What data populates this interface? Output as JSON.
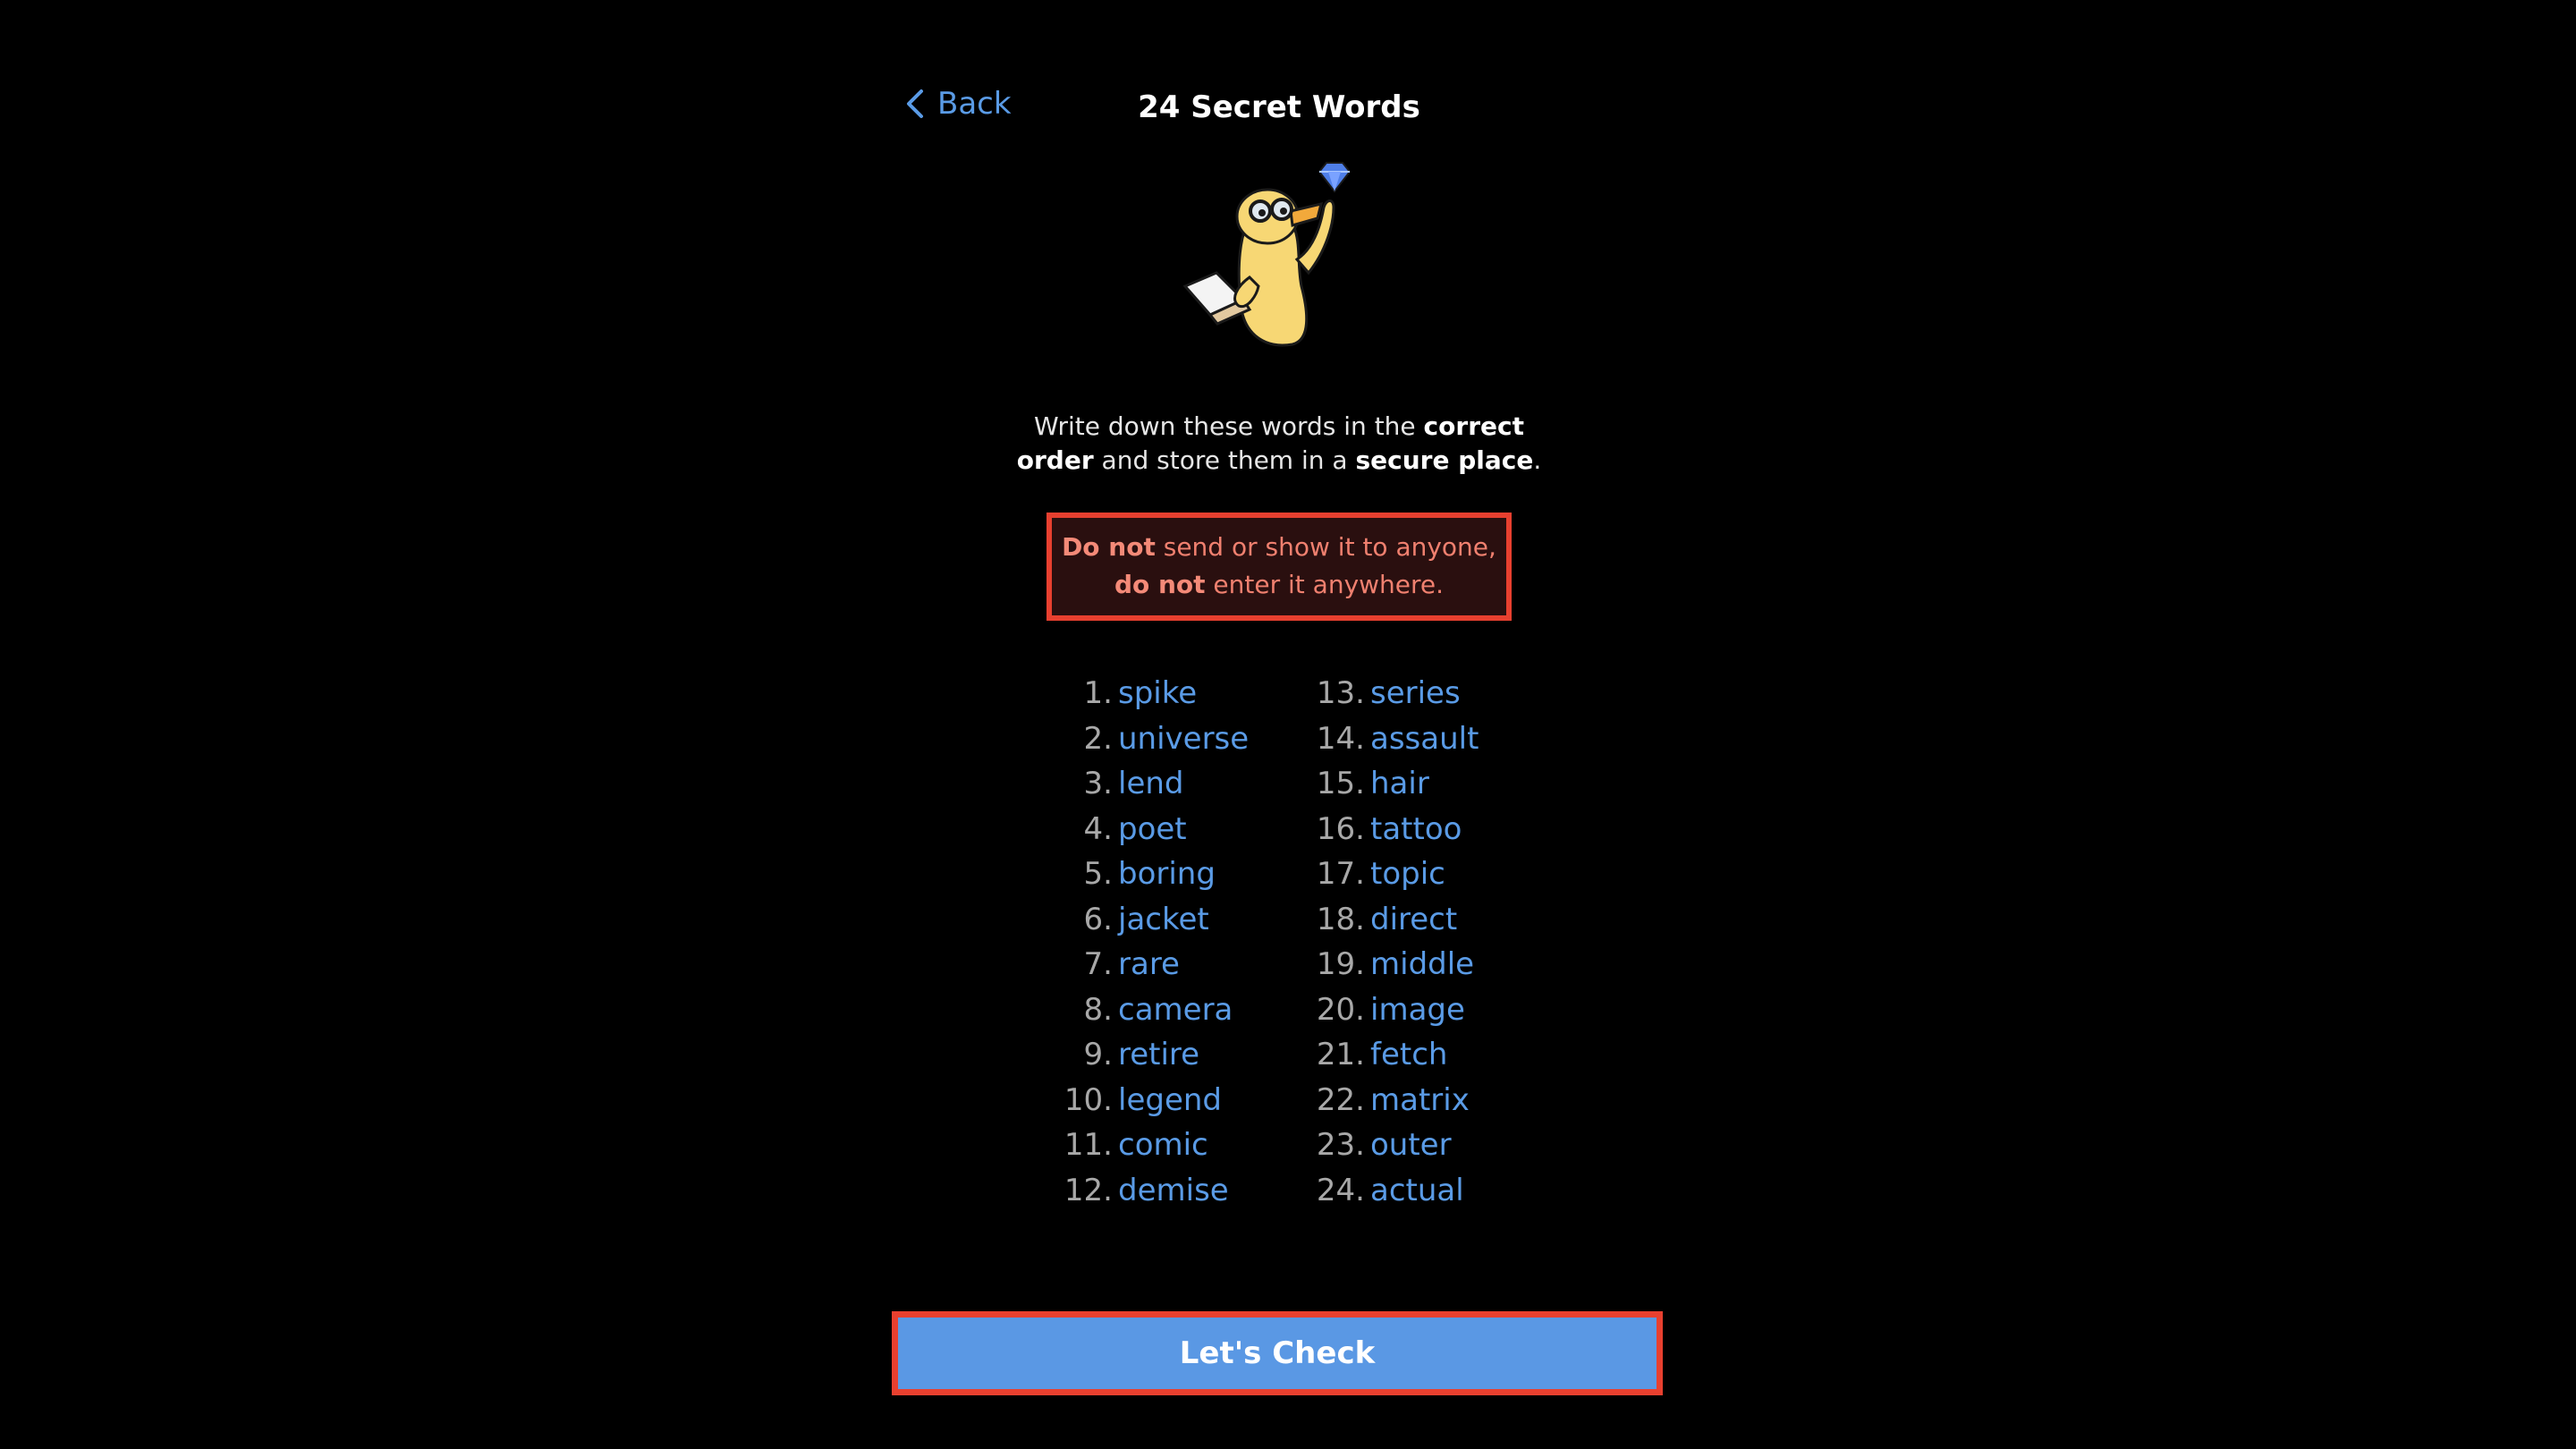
{
  "header": {
    "back_label": "Back",
    "title": "24 Secret Words"
  },
  "intro": {
    "part1": "Write down these words in the ",
    "bold1": "correct order",
    "part2": " and store them in a ",
    "bold2": "secure place",
    "part3": "."
  },
  "warning": {
    "bold1": "Do not",
    "text1": " send or show it to anyone,",
    "bold2": "do not",
    "text2": " enter it anywhere."
  },
  "words": [
    {
      "n": "1.",
      "w": "spike"
    },
    {
      "n": "2.",
      "w": "universe"
    },
    {
      "n": "3.",
      "w": "lend"
    },
    {
      "n": "4.",
      "w": "poet"
    },
    {
      "n": "5.",
      "w": "boring"
    },
    {
      "n": "6.",
      "w": "jacket"
    },
    {
      "n": "7.",
      "w": "rare"
    },
    {
      "n": "8.",
      "w": "camera"
    },
    {
      "n": "9.",
      "w": "retire"
    },
    {
      "n": "10.",
      "w": "legend"
    },
    {
      "n": "11.",
      "w": "comic"
    },
    {
      "n": "12.",
      "w": "demise"
    },
    {
      "n": "13.",
      "w": "series"
    },
    {
      "n": "14.",
      "w": "assault"
    },
    {
      "n": "15.",
      "w": "hair"
    },
    {
      "n": "16.",
      "w": "tattoo"
    },
    {
      "n": "17.",
      "w": "topic"
    },
    {
      "n": "18.",
      "w": "direct"
    },
    {
      "n": "19.",
      "w": "middle"
    },
    {
      "n": "20.",
      "w": "image"
    },
    {
      "n": "21.",
      "w": "fetch"
    },
    {
      "n": "22.",
      "w": "matrix"
    },
    {
      "n": "23.",
      "w": "outer"
    },
    {
      "n": "24.",
      "w": "actual"
    }
  ],
  "actions": {
    "check_label": "Let's Check"
  },
  "icons": {
    "back": "chevron-left-icon",
    "mascot": "duck-mascot-icon",
    "gem": "diamond-icon"
  },
  "colors": {
    "accent": "#5a9be6",
    "button": "#5a98e4",
    "warning_border": "#e8402f",
    "warning_text": "#f0806f",
    "background": "#000000"
  }
}
